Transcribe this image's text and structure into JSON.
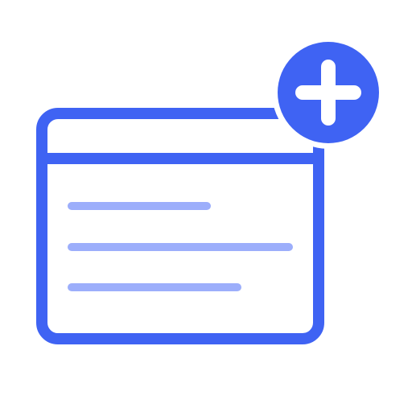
{
  "icon": {
    "name": "add-window-icon",
    "parts": {
      "window": "browser-window-icon",
      "badge": "plus-circle-icon",
      "lines": "text-lines-icon"
    }
  },
  "colors": {
    "background": "#ffffff",
    "primary": "#3f63f3",
    "secondary": "#9caefb",
    "badge_symbol": "#ffffff"
  }
}
